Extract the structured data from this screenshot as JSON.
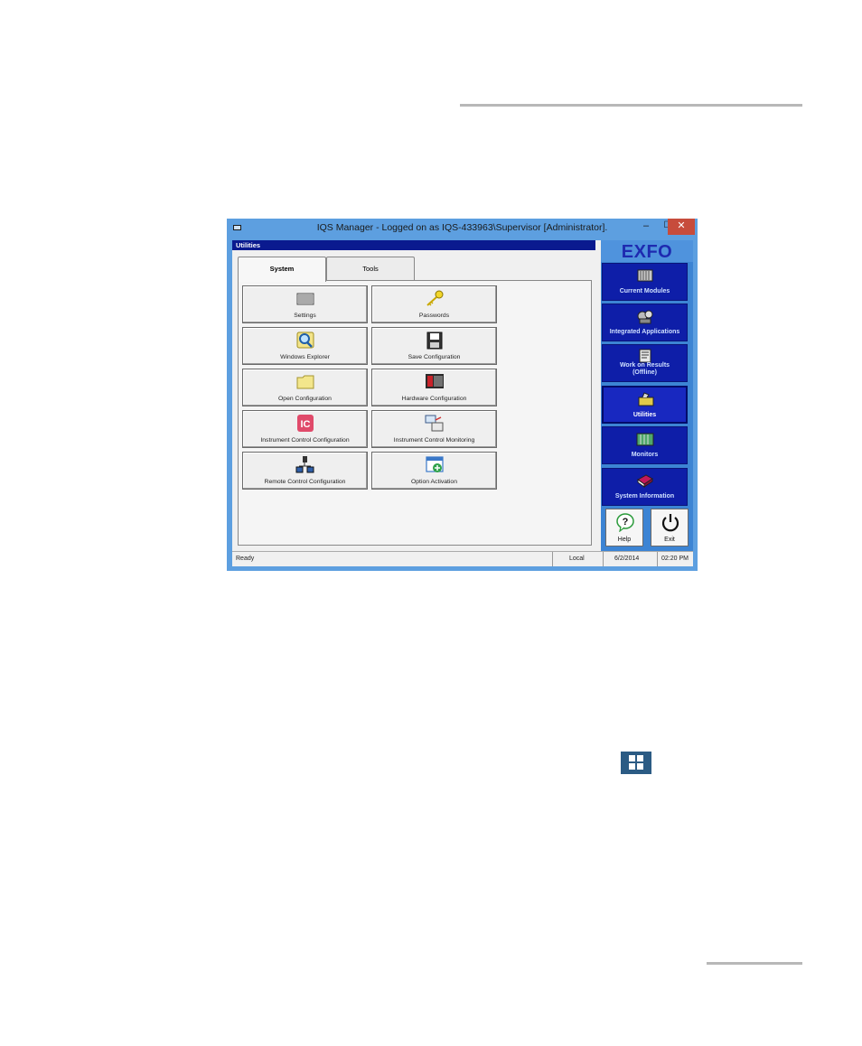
{
  "window": {
    "title": "IQS Manager - Logged on as IQS-433963\\Supervisor [Administrator].",
    "minimize_glyph": "–",
    "maximize_glyph": "☐",
    "close_glyph": "✕"
  },
  "panel": {
    "header": "Utilities"
  },
  "tabs": [
    {
      "label": "System",
      "selected": true
    },
    {
      "label": "Tools",
      "selected": false
    }
  ],
  "tiles": [
    {
      "label": "Settings",
      "icon": "settings-icon"
    },
    {
      "label": "Passwords",
      "icon": "key-icon"
    },
    {
      "label": "Windows Explorer",
      "icon": "magnifier-icon"
    },
    {
      "label": "Save Configuration",
      "icon": "floppy-disk-icon"
    },
    {
      "label": "Open Configuration",
      "icon": "folder-icon"
    },
    {
      "label": "Hardware Configuration",
      "icon": "hardware-icon"
    },
    {
      "label": "Instrument Control Configuration",
      "icon": "ic-icon"
    },
    {
      "label": "Instrument Control Monitoring",
      "icon": "monitoring-icon"
    },
    {
      "label": "Remote Control Configuration",
      "icon": "network-icon"
    },
    {
      "label": "Option Activation",
      "icon": "add-window-icon"
    }
  ],
  "sidebar": {
    "logo": "EXFO",
    "items": [
      {
        "label": "Current Modules",
        "icon": "modules-icon"
      },
      {
        "label": "Integrated Applications",
        "icon": "applications-icon"
      },
      {
        "label_line1": "Work on Results",
        "label_line2": "(Offline)",
        "icon": "results-icon"
      },
      {
        "label": "Utilities",
        "icon": "toolbox-icon",
        "active": true
      },
      {
        "label": "Monitors",
        "icon": "monitors-icon"
      },
      {
        "label": "System Information",
        "icon": "book-icon"
      }
    ],
    "help_label": "Help",
    "exit_label": "Exit"
  },
  "statusbar": {
    "status": "Ready",
    "mode": "Local",
    "date": "6/2/2014",
    "time": "02:20 PM"
  },
  "colors": {
    "nav_blue": "#0e1ea8",
    "title_blue": "#5d9fe0",
    "header_navy": "#0a1a8f"
  }
}
